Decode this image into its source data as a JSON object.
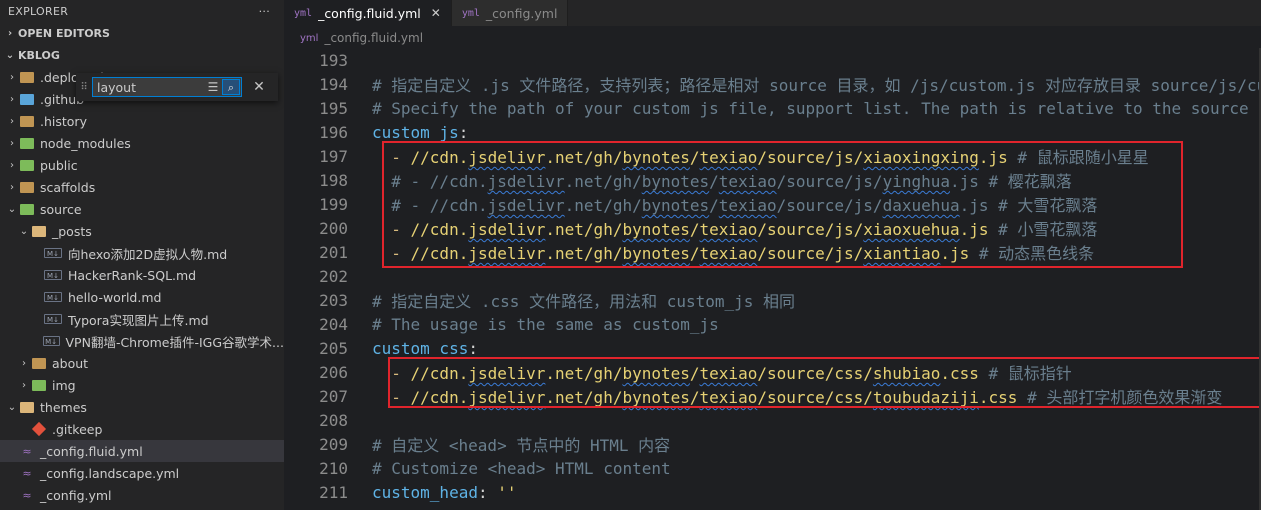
{
  "sidebar": {
    "title": "EXPLORER",
    "more_label": "···",
    "open_editors": "OPEN EDITORS",
    "project": "KBLOG",
    "tree": [
      {
        "label": ".deploy_git",
        "type": "folder",
        "icon": "folder-icon",
        "depth": 0,
        "expanded": false
      },
      {
        "label": ".github",
        "type": "folder",
        "icon": "github-folder-icon",
        "depth": 0,
        "expanded": false
      },
      {
        "label": ".history",
        "type": "folder",
        "icon": "folder-icon",
        "depth": 0,
        "expanded": false
      },
      {
        "label": "node_modules",
        "type": "folder",
        "icon": "node-folder-icon",
        "depth": 0,
        "expanded": false
      },
      {
        "label": "public",
        "type": "folder",
        "icon": "public-folder-icon",
        "depth": 0,
        "expanded": false
      },
      {
        "label": "scaffolds",
        "type": "folder",
        "icon": "folder-icon",
        "depth": 0,
        "expanded": false
      },
      {
        "label": "source",
        "type": "folder",
        "icon": "source-folder-icon",
        "depth": 0,
        "expanded": true
      },
      {
        "label": "_posts",
        "type": "folder",
        "icon": "folder-open-icon",
        "depth": 1,
        "expanded": true
      },
      {
        "label": "向hexo添加2D虚拟人物.md",
        "type": "md",
        "icon": "markdown-icon",
        "depth": 2
      },
      {
        "label": "HackerRank-SQL.md",
        "type": "md",
        "icon": "markdown-icon",
        "depth": 2
      },
      {
        "label": "hello-world.md",
        "type": "md",
        "icon": "markdown-icon",
        "depth": 2
      },
      {
        "label": "Typora实现图片上传.md",
        "type": "md",
        "icon": "markdown-icon",
        "depth": 2
      },
      {
        "label": "VPN翻墙-Chrome插件-IGG谷歌学术...",
        "type": "md",
        "icon": "markdown-icon",
        "depth": 2
      },
      {
        "label": "about",
        "type": "folder",
        "icon": "folder-icon",
        "depth": 1,
        "expanded": false
      },
      {
        "label": "img",
        "type": "folder",
        "icon": "image-folder-icon",
        "depth": 1,
        "expanded": false
      },
      {
        "label": "themes",
        "type": "folder",
        "icon": "folder-open-icon",
        "depth": 0,
        "expanded": true
      },
      {
        "label": ".gitkeep",
        "type": "git",
        "icon": "git-icon",
        "depth": 1
      },
      {
        "label": "_config.fluid.yml",
        "type": "yml",
        "icon": "yaml-icon",
        "depth": 0,
        "active": true
      },
      {
        "label": "_config.landscape.yml",
        "type": "yml",
        "icon": "yaml-icon",
        "depth": 0
      },
      {
        "label": "_config.yml",
        "type": "yml",
        "icon": "yaml-icon",
        "depth": 0
      }
    ],
    "find": {
      "value": "layout",
      "filter_icon": "filter-icon",
      "fuzzy_icon": "fuzzy-match-icon",
      "close_icon": "close-icon"
    }
  },
  "editor": {
    "tabs": [
      {
        "label": "_config.fluid.yml",
        "active": true,
        "close": "✕"
      },
      {
        "label": "_config.yml",
        "active": false
      }
    ],
    "breadcrumb": "_config.fluid.yml",
    "lines": [
      {
        "n": "193",
        "parts": []
      },
      {
        "n": "194",
        "parts": [
          {
            "t": "# 指定自定义 .js 文件路径，支持列表；路径是相对 source 目录，如 /js/custom.js 对应存放目录 source/js/custom.js",
            "c": "cmt"
          }
        ]
      },
      {
        "n": "195",
        "parts": [
          {
            "t": "# Specify the path of your custom js file, support list. The path is relative to the source directory",
            "c": "cmt"
          }
        ]
      },
      {
        "n": "196",
        "parts": [
          {
            "t": "custom_js",
            "c": "key"
          },
          {
            "t": ":",
            "c": ""
          }
        ]
      },
      {
        "n": "197",
        "parts": [
          {
            "t": "  - ",
            "c": "dash"
          },
          {
            "t": "//cdn.",
            "c": "str"
          },
          {
            "t": "jsdelivr",
            "c": "str squig"
          },
          {
            "t": ".net/gh/",
            "c": "str"
          },
          {
            "t": "bynotes",
            "c": "str squig"
          },
          {
            "t": "/",
            "c": "str"
          },
          {
            "t": "texiao",
            "c": "str squig"
          },
          {
            "t": "/source/js/",
            "c": "str"
          },
          {
            "t": "xiaoxingxing",
            "c": "str squig"
          },
          {
            "t": ".js ",
            "c": "str"
          },
          {
            "t": "# 鼠标跟随小星星",
            "c": "cmt"
          }
        ]
      },
      {
        "n": "198",
        "parts": [
          {
            "t": "  # - //cdn.",
            "c": "cmt"
          },
          {
            "t": "jsdelivr",
            "c": "cmt squig"
          },
          {
            "t": ".net/gh/",
            "c": "cmt"
          },
          {
            "t": "bynotes",
            "c": "cmt squig"
          },
          {
            "t": "/",
            "c": "cmt"
          },
          {
            "t": "texiao",
            "c": "cmt squig"
          },
          {
            "t": "/source/js/",
            "c": "cmt"
          },
          {
            "t": "yinghua",
            "c": "cmt squig"
          },
          {
            "t": ".js # 樱花飘落",
            "c": "cmt"
          }
        ]
      },
      {
        "n": "199",
        "parts": [
          {
            "t": "  # - //cdn.",
            "c": "cmt"
          },
          {
            "t": "jsdelivr",
            "c": "cmt squig"
          },
          {
            "t": ".net/gh/",
            "c": "cmt"
          },
          {
            "t": "bynotes",
            "c": "cmt squig"
          },
          {
            "t": "/",
            "c": "cmt"
          },
          {
            "t": "texiao",
            "c": "cmt squig"
          },
          {
            "t": "/source/js/",
            "c": "cmt"
          },
          {
            "t": "daxuehua",
            "c": "cmt squig"
          },
          {
            "t": ".js # 大雪花飘落",
            "c": "cmt"
          }
        ]
      },
      {
        "n": "200",
        "parts": [
          {
            "t": "  - ",
            "c": "dash"
          },
          {
            "t": "//cdn.",
            "c": "str"
          },
          {
            "t": "jsdelivr",
            "c": "str squig"
          },
          {
            "t": ".net/gh/",
            "c": "str"
          },
          {
            "t": "bynotes",
            "c": "str squig"
          },
          {
            "t": "/",
            "c": "str"
          },
          {
            "t": "texiao",
            "c": "str squig"
          },
          {
            "t": "/source/js/",
            "c": "str"
          },
          {
            "t": "xiaoxuehua",
            "c": "str squig"
          },
          {
            "t": ".js ",
            "c": "str"
          },
          {
            "t": "# 小雪花飘落",
            "c": "cmt"
          }
        ]
      },
      {
        "n": "201",
        "parts": [
          {
            "t": "  - ",
            "c": "dash"
          },
          {
            "t": "//cdn.",
            "c": "str"
          },
          {
            "t": "jsdelivr",
            "c": "str squig"
          },
          {
            "t": ".net/gh/",
            "c": "str"
          },
          {
            "t": "bynotes",
            "c": "str squig"
          },
          {
            "t": "/",
            "c": "str"
          },
          {
            "t": "texiao",
            "c": "str squig"
          },
          {
            "t": "/source/js/",
            "c": "str"
          },
          {
            "t": "xiantiao",
            "c": "str squig"
          },
          {
            "t": ".js ",
            "c": "str"
          },
          {
            "t": "# 动态黑色线条",
            "c": "cmt"
          }
        ]
      },
      {
        "n": "202",
        "parts": []
      },
      {
        "n": "203",
        "parts": [
          {
            "t": "# 指定自定义 .css 文件路径，用法和 custom_js 相同",
            "c": "cmt"
          }
        ]
      },
      {
        "n": "204",
        "parts": [
          {
            "t": "# The usage is the same as custom_js",
            "c": "cmt"
          }
        ]
      },
      {
        "n": "205",
        "parts": [
          {
            "t": "custom_css",
            "c": "key"
          },
          {
            "t": ":",
            "c": ""
          }
        ]
      },
      {
        "n": "206",
        "parts": [
          {
            "t": "  - ",
            "c": "dash"
          },
          {
            "t": "//cdn.",
            "c": "str"
          },
          {
            "t": "jsdelivr",
            "c": "str squig"
          },
          {
            "t": ".net/gh/",
            "c": "str"
          },
          {
            "t": "bynotes",
            "c": "str squig"
          },
          {
            "t": "/",
            "c": "str"
          },
          {
            "t": "texiao",
            "c": "str squig"
          },
          {
            "t": "/source/css/",
            "c": "str"
          },
          {
            "t": "shubiao",
            "c": "str squig"
          },
          {
            "t": ".css ",
            "c": "str"
          },
          {
            "t": "# 鼠标指针",
            "c": "cmt"
          }
        ]
      },
      {
        "n": "207",
        "parts": [
          {
            "t": "  - ",
            "c": "dash"
          },
          {
            "t": "//cdn.",
            "c": "str"
          },
          {
            "t": "jsdelivr",
            "c": "str squig"
          },
          {
            "t": ".net/gh/",
            "c": "str"
          },
          {
            "t": "bynotes",
            "c": "str squig"
          },
          {
            "t": "/",
            "c": "str"
          },
          {
            "t": "texiao",
            "c": "str squig"
          },
          {
            "t": "/source/css/",
            "c": "str"
          },
          {
            "t": "toubudaziji",
            "c": "str squig"
          },
          {
            "t": ".css ",
            "c": "str"
          },
          {
            "t": "# 头部打字机颜色效果渐变",
            "c": "cmt"
          }
        ]
      },
      {
        "n": "208",
        "parts": []
      },
      {
        "n": "209",
        "parts": [
          {
            "t": "# 自定义 <head> 节点中的 HTML 内容",
            "c": "cmt"
          }
        ]
      },
      {
        "n": "210",
        "parts": [
          {
            "t": "# Customize <head> HTML content",
            "c": "cmt"
          }
        ]
      },
      {
        "n": "211",
        "parts": [
          {
            "t": "custom_head",
            "c": "key"
          },
          {
            "t": ": ",
            "c": ""
          },
          {
            "t": "''",
            "c": "str"
          }
        ]
      },
      {
        "n": "212",
        "parts": []
      }
    ]
  }
}
